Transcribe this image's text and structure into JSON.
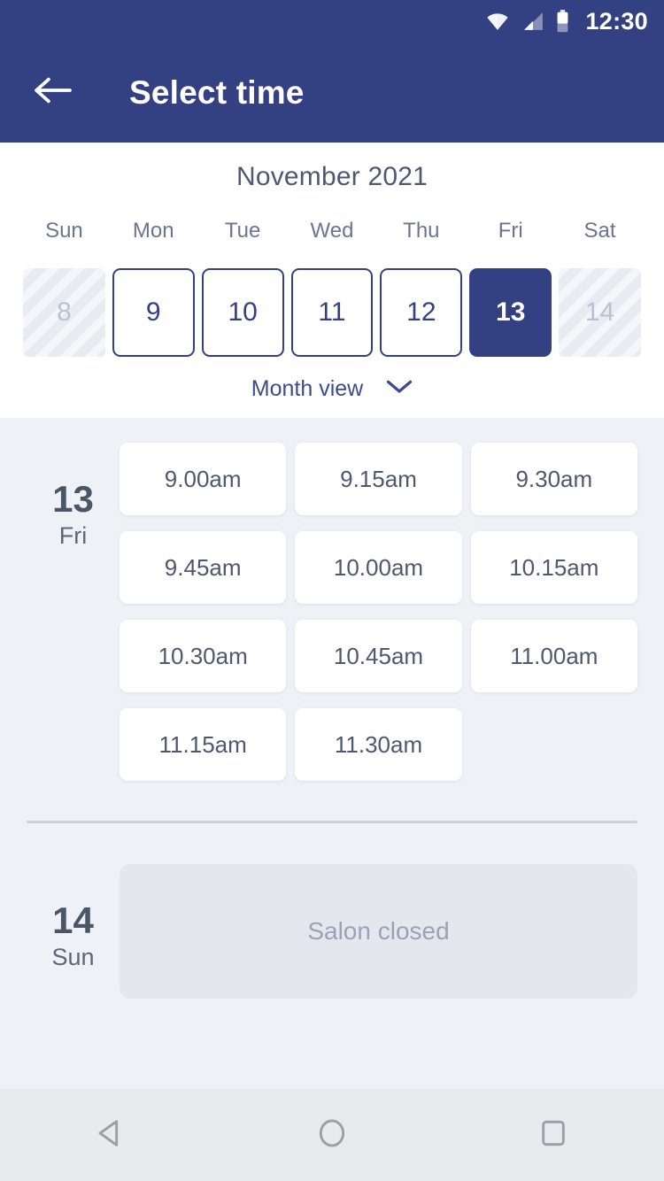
{
  "theme": {
    "primary": "#334183",
    "page_bg": "#eef1f6",
    "card_bg": "#ffffff",
    "text_dark": "#4e5870",
    "text_muted": "#6b7590",
    "closed_bg": "#e4e8ee"
  },
  "status_bar": {
    "time": "12:30",
    "icons": [
      "wifi-icon",
      "cellular-signal-icon",
      "battery-icon"
    ]
  },
  "app_bar": {
    "back_icon": "arrow-left-icon",
    "title": "Select time"
  },
  "calendar": {
    "month_title": "November 2021",
    "day_of_week_labels": [
      "Sun",
      "Mon",
      "Tue",
      "Wed",
      "Thu",
      "Fri",
      "Sat"
    ],
    "days": [
      {
        "num": "8",
        "state": "disabled"
      },
      {
        "num": "9",
        "state": "enabled"
      },
      {
        "num": "10",
        "state": "enabled"
      },
      {
        "num": "11",
        "state": "enabled"
      },
      {
        "num": "12",
        "state": "enabled"
      },
      {
        "num": "13",
        "state": "selected"
      },
      {
        "num": "14",
        "state": "disabled"
      }
    ],
    "view_toggle": {
      "label": "Month view",
      "icon": "chevron-down-icon"
    }
  },
  "schedule": [
    {
      "date_num": "13",
      "date_dow": "Fri",
      "slots": [
        "9.00am",
        "9.15am",
        "9.30am",
        "9.45am",
        "10.00am",
        "10.15am",
        "10.30am",
        "10.45am",
        "11.00am",
        "11.15am",
        "11.30am"
      ],
      "closed_message": null
    },
    {
      "date_num": "14",
      "date_dow": "Sun",
      "slots": [],
      "closed_message": "Salon closed"
    }
  ],
  "nav_bar": {
    "buttons": [
      {
        "name": "back-nav-button",
        "icon": "triangle-back-icon"
      },
      {
        "name": "home-nav-button",
        "icon": "circle-home-icon"
      },
      {
        "name": "recents-nav-button",
        "icon": "square-recents-icon"
      }
    ]
  }
}
